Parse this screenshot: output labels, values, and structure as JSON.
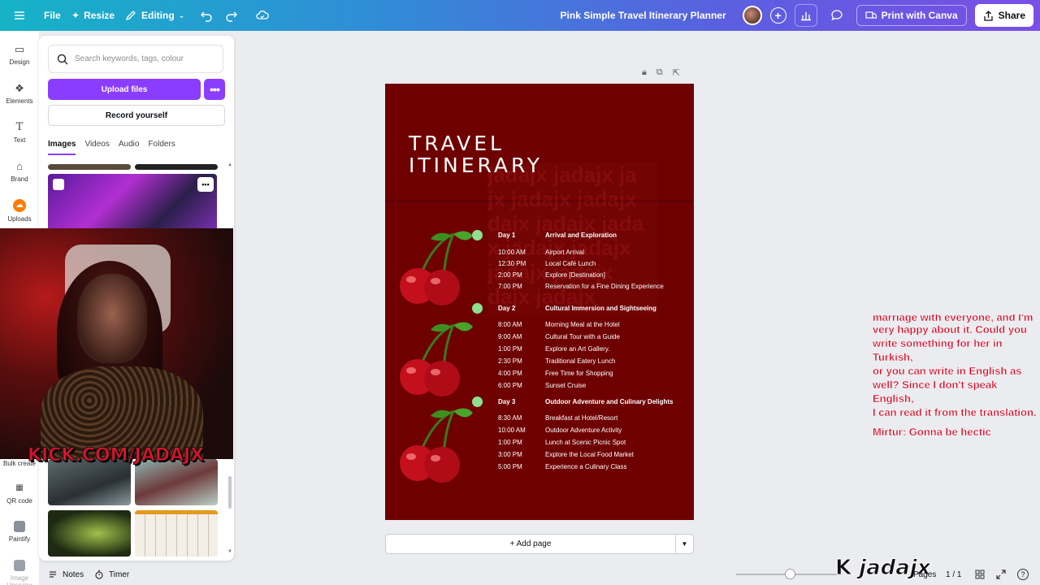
{
  "topbar": {
    "file": "File",
    "resize": "Resize",
    "editing": "Editing",
    "doc_title": "Pink Simple Travel Itinerary Planner",
    "print": "Print with Canva",
    "share": "Share"
  },
  "rail": {
    "items": [
      "Design",
      "Elements",
      "Text",
      "Brand",
      "Uploads",
      "Bulk create",
      "QR code",
      "Paintify",
      "Image Upscaler"
    ]
  },
  "panel": {
    "search_placeholder": "Search keywords, tags, colour",
    "upload_label": "Upload files",
    "record_label": "Record yourself",
    "tabs": [
      "Images",
      "Videos",
      "Audio",
      "Folders"
    ],
    "active_tab": "Images"
  },
  "stream": {
    "kick_text": "KICK.COM/JADAJX",
    "logo_text": "jadajx",
    "chat_lines": [
      "marriage with everyone, and I'm",
      "very happy about it. Could you",
      "write something for her in Turkish,",
      "or you can write in English as",
      "well? Since I don't speak English,",
      "I can read it from the translation."
    ],
    "chat_reply": "Mirtur: Gonna be hectic"
  },
  "design": {
    "title_line1": "TRAVEL",
    "title_line2": "ITINERARY",
    "watermark": "jadajx",
    "days": [
      {
        "day": "Day 1",
        "theme": "Arrival and Exploration",
        "items": [
          {
            "time": "10:00 AM",
            "activity": "Airport Arrival"
          },
          {
            "time": "12:30 PM",
            "activity": "Local Café Lunch"
          },
          {
            "time": "2:00 PM",
            "activity": "Explore [Destination]"
          },
          {
            "time": "7:00 PM",
            "activity": "Reservation for a Fine Dining Experience"
          }
        ]
      },
      {
        "day": "Day 2",
        "theme": "Cultural Immersion and Sightseeing",
        "items": [
          {
            "time": "8:00 AM",
            "activity": "Morning Meal at the Hotel"
          },
          {
            "time": "9:00 AM",
            "activity": "Cultural Tour with a Guide"
          },
          {
            "time": "1:00 PM",
            "activity": "Explore an Art Gallery."
          },
          {
            "time": "2:30 PM",
            "activity": "Traditional Eatery Lunch"
          },
          {
            "time": "4:00 PM",
            "activity": "Free Time for Shopping"
          },
          {
            "time": "6:00 PM",
            "activity": "Sunset Cruise"
          }
        ]
      },
      {
        "day": "Day 3",
        "theme": "Outdoor Adventure and Culinary Delights",
        "items": [
          {
            "time": "8:30 AM",
            "activity": "Breakfast at Hotel/Resort"
          },
          {
            "time": "10:00 AM",
            "activity": "Outdoor Adventure Activity"
          },
          {
            "time": "1:00 PM",
            "activity": "Lunch at Scenic Picnic Spot"
          },
          {
            "time": "3:00 PM",
            "activity": "Explore the Local Food Market"
          },
          {
            "time": "5:00 PM",
            "activity": "Experience a Culinary Class"
          }
        ]
      }
    ]
  },
  "canvas": {
    "add_page": "+ Add page"
  },
  "bottom": {
    "notes": "Notes",
    "timer": "Timer",
    "pages": "Pages",
    "page_count": "1 / 1"
  },
  "colors": {
    "accent": "#8b3dff",
    "design_bg": "#6e0000",
    "dot": "#8ee08e"
  }
}
